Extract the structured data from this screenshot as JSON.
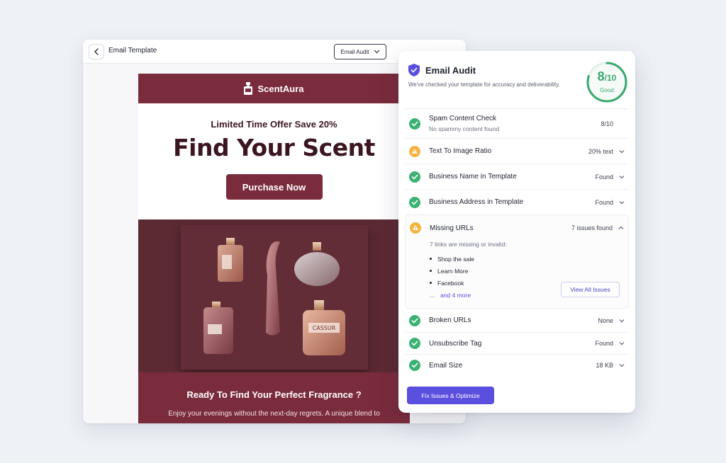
{
  "editor": {
    "title": "Email Template",
    "audit_select": "Email Audit"
  },
  "email": {
    "brand": "ScentAura",
    "offer": "Limited Time Offer Save 20%",
    "headline": "Find Your Scent",
    "cta": "Purchase Now",
    "section_title": "Ready To Find Your Perfect  Fragrance ?",
    "section_text": "Enjoy your evenings without the next-day regrets. A unique blend to",
    "bottle_label": "CASSUR",
    "colors": {
      "brand": "#7a2b3c",
      "hero": "#5c2a33"
    }
  },
  "audit": {
    "title": "Email Audit",
    "subtitle": "We've checked your template for accuracy and deliverability.",
    "score": "8",
    "score_total": "/10",
    "score_label": "Good",
    "checks": [
      {
        "label": "Spam Content Check",
        "note": "No spammy content found",
        "value": "8/10",
        "status": "pass",
        "icon": "check-circle-icon"
      },
      {
        "label": "Text To Image Ratio",
        "value": "20% text",
        "status": "warning",
        "icon": "warning-icon"
      },
      {
        "label": "Business Name in Template",
        "value": "Found",
        "status": "pass",
        "icon": "check-circle-icon"
      },
      {
        "label": "Business Address in Template",
        "value": "Found",
        "status": "pass",
        "icon": "check-circle-icon"
      },
      {
        "label": "Missing URLs",
        "value": "7 issues found",
        "status": "warning",
        "icon": "warning-icon"
      },
      {
        "label": "Broken URLs",
        "value": "None",
        "status": "pass",
        "icon": "check-circle-icon"
      },
      {
        "label": "Unsubscribe Tag",
        "value": "Found",
        "status": "pass",
        "icon": "check-circle-icon"
      },
      {
        "label": "Email Size",
        "value": "18 KB",
        "status": "pass",
        "icon": "check-circle-icon"
      }
    ],
    "missing_urls": {
      "intro": "7 links are missing or invalid:",
      "links": [
        "Shop the sale",
        "Learn More",
        "Facebook"
      ],
      "more": "and 4 more",
      "ellipsis": "...",
      "view_all": "View All Issues"
    },
    "fix_button": "Fix Issues & Optimize",
    "colors": {
      "pass": "#3bb273",
      "warning": "#f6b33d",
      "accent": "#5b4fe0"
    }
  }
}
